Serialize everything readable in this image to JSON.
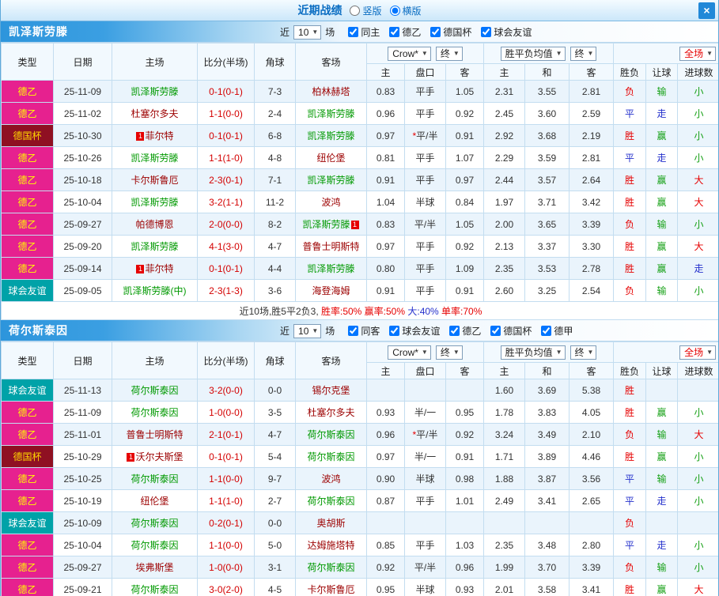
{
  "titlebar": {
    "title": "近期战绩",
    "vertical_label": "竖版",
    "horizontal_label": "横版",
    "close_label": "×"
  },
  "filter": {
    "near": "近",
    "matches": "场"
  },
  "table_header": {
    "type": "类型",
    "date": "日期",
    "home": "主场",
    "score": "比分(半场)",
    "corner": "角球",
    "away": "客场",
    "crown_select": "Crow*",
    "final_select": "终",
    "avg_select": "胜平负均值",
    "final2_select": "终",
    "full_select": "全场",
    "sub_home": "主",
    "sub_handicap": "盘口",
    "sub_away": "客",
    "sub_avg_home": "主",
    "sub_draw": "和",
    "sub_avg_away": "客",
    "sub_result": "胜负",
    "sub_handicap_result": "让球",
    "sub_goals": "进球数"
  },
  "league_colors": {
    "德乙": {
      "bg": "#e6218f",
      "fg": "#ffff00"
    },
    "德国杯": {
      "bg": "#8f1022",
      "fg": "#ffd800"
    },
    "球会友谊": {
      "bg": "#00a2a8",
      "fg": "#ffffff"
    }
  },
  "result_colors": {
    "胜": "#e60000",
    "平": "#2430cc",
    "负": "#e60000",
    "赢": "#15a015",
    "走": "#2430cc",
    "输": "#15a015",
    "大": "#e60000",
    "小": "#15a015"
  },
  "teams": [
    {
      "name": "凯泽斯劳滕",
      "games_count": "10",
      "filters": [
        "同主",
        "德乙",
        "德国杯",
        "球会友谊"
      ],
      "rows": [
        {
          "type": "德乙",
          "date": "25-11-09",
          "home": {
            "name": "凯泽斯劳滕",
            "self": true
          },
          "score": "0-1(0-1)",
          "corner": "7-3",
          "away": {
            "name": "柏林赫塔",
            "self": false
          },
          "odds": [
            "0.83",
            "平手",
            "1.05"
          ],
          "avg": [
            "2.31",
            "3.55",
            "2.81"
          ],
          "result": [
            "负",
            "输",
            "小"
          ]
        },
        {
          "type": "德乙",
          "date": "25-11-02",
          "home": {
            "name": "杜塞尔多夫",
            "self": false
          },
          "score": "1-1(0-0)",
          "corner": "2-4",
          "away": {
            "name": "凯泽斯劳滕",
            "self": true
          },
          "odds": [
            "0.96",
            "平手",
            "0.92"
          ],
          "avg": [
            "2.45",
            "3.60",
            "2.59"
          ],
          "result": [
            "平",
            "走",
            "小"
          ]
        },
        {
          "type": "德国杯",
          "date": "25-10-30",
          "home": {
            "name": "菲尔特",
            "self": false,
            "badge": "1",
            "badge_side": "left"
          },
          "score": "0-1(0-1)",
          "corner": "6-8",
          "away": {
            "name": "凯泽斯劳滕",
            "self": true
          },
          "odds": [
            "0.97",
            "*平/半",
            "0.91"
          ],
          "avg": [
            "2.92",
            "3.68",
            "2.19"
          ],
          "result": [
            "胜",
            "赢",
            "小"
          ]
        },
        {
          "type": "德乙",
          "date": "25-10-26",
          "home": {
            "name": "凯泽斯劳滕",
            "self": true
          },
          "score": "1-1(1-0)",
          "corner": "4-8",
          "away": {
            "name": "纽伦堡",
            "self": false
          },
          "odds": [
            "0.81",
            "平手",
            "1.07"
          ],
          "avg": [
            "2.29",
            "3.59",
            "2.81"
          ],
          "result": [
            "平",
            "走",
            "小"
          ]
        },
        {
          "type": "德乙",
          "date": "25-10-18",
          "home": {
            "name": "卡尔斯鲁厄",
            "self": false
          },
          "score": "2-3(0-1)",
          "corner": "7-1",
          "away": {
            "name": "凯泽斯劳滕",
            "self": true
          },
          "odds": [
            "0.91",
            "平手",
            "0.97"
          ],
          "avg": [
            "2.44",
            "3.57",
            "2.64"
          ],
          "result": [
            "胜",
            "赢",
            "大"
          ]
        },
        {
          "type": "德乙",
          "date": "25-10-04",
          "home": {
            "name": "凯泽斯劳滕",
            "self": true
          },
          "score": "3-2(1-1)",
          "corner": "11-2",
          "away": {
            "name": "波鸿",
            "self": false
          },
          "odds": [
            "1.04",
            "半球",
            "0.84"
          ],
          "avg": [
            "1.97",
            "3.71",
            "3.42"
          ],
          "result": [
            "胜",
            "赢",
            "大"
          ]
        },
        {
          "type": "德乙",
          "date": "25-09-27",
          "home": {
            "name": "帕德博恩",
            "self": false
          },
          "score": "2-0(0-0)",
          "corner": "8-2",
          "away": {
            "name": "凯泽斯劳滕",
            "self": true,
            "badge": "1",
            "badge_side": "right"
          },
          "odds": [
            "0.83",
            "平/半",
            "1.05"
          ],
          "avg": [
            "2.00",
            "3.65",
            "3.39"
          ],
          "result": [
            "负",
            "输",
            "小"
          ]
        },
        {
          "type": "德乙",
          "date": "25-09-20",
          "home": {
            "name": "凯泽斯劳滕",
            "self": true
          },
          "score": "4-1(3-0)",
          "corner": "4-7",
          "away": {
            "name": "普鲁士明斯特",
            "self": false
          },
          "odds": [
            "0.97",
            "平手",
            "0.92"
          ],
          "avg": [
            "2.13",
            "3.37",
            "3.30"
          ],
          "result": [
            "胜",
            "赢",
            "大"
          ]
        },
        {
          "type": "德乙",
          "date": "25-09-14",
          "home": {
            "name": "菲尔特",
            "self": false,
            "badge": "1",
            "badge_side": "left"
          },
          "score": "0-1(0-1)",
          "corner": "4-4",
          "away": {
            "name": "凯泽斯劳滕",
            "self": true
          },
          "odds": [
            "0.80",
            "平手",
            "1.09"
          ],
          "avg": [
            "2.35",
            "3.53",
            "2.78"
          ],
          "result": [
            "胜",
            "赢",
            "走"
          ]
        },
        {
          "type": "球会友谊",
          "date": "25-09-05",
          "home": {
            "name": "凯泽斯劳滕(中)",
            "self": true
          },
          "score": "2-3(1-3)",
          "corner": "3-6",
          "away": {
            "name": "海登海姆",
            "self": false
          },
          "odds": [
            "0.91",
            "平手",
            "0.91"
          ],
          "avg": [
            "2.60",
            "3.25",
            "2.54"
          ],
          "result": [
            "负",
            "输",
            "小"
          ]
        }
      ],
      "summary_segments": [
        {
          "text": "近10场,胜5平2负3, ",
          "color": "#333333"
        },
        {
          "text": "胜率:50%",
          "color": "#e60000"
        },
        {
          "text": " 赢率:50%",
          "color": "#e60000"
        },
        {
          "text": " 大:40%",
          "color": "#2430cc"
        },
        {
          "text": " 单率:70%",
          "color": "#e60000"
        }
      ]
    },
    {
      "name": "荷尔斯泰因",
      "games_count": "10",
      "filters": [
        "同客",
        "球会友谊",
        "德乙",
        "德国杯",
        "德甲"
      ],
      "rows": [
        {
          "type": "球会友谊",
          "date": "25-11-13",
          "home": {
            "name": "荷尔斯泰因",
            "self": true
          },
          "score": "3-2(0-0)",
          "corner": "0-0",
          "away": {
            "name": "锡尔克堡",
            "self": false
          },
          "odds": [
            "",
            "",
            ""
          ],
          "avg": [
            "1.60",
            "3.69",
            "5.38"
          ],
          "result": [
            "胜",
            "",
            ""
          ]
        },
        {
          "type": "德乙",
          "date": "25-11-09",
          "home": {
            "name": "荷尔斯泰因",
            "self": true
          },
          "score": "1-0(0-0)",
          "corner": "3-5",
          "away": {
            "name": "杜塞尔多夫",
            "self": false
          },
          "odds": [
            "0.93",
            "半/一",
            "0.95"
          ],
          "avg": [
            "1.78",
            "3.83",
            "4.05"
          ],
          "result": [
            "胜",
            "赢",
            "小"
          ]
        },
        {
          "type": "德乙",
          "date": "25-11-01",
          "home": {
            "name": "普鲁士明斯特",
            "self": false
          },
          "score": "2-1(0-1)",
          "corner": "4-7",
          "away": {
            "name": "荷尔斯泰因",
            "self": true
          },
          "odds": [
            "0.96",
            "*平/半",
            "0.92"
          ],
          "avg": [
            "3.24",
            "3.49",
            "2.10"
          ],
          "result": [
            "负",
            "输",
            "大"
          ]
        },
        {
          "type": "德国杯",
          "date": "25-10-29",
          "home": {
            "name": "沃尔夫斯堡",
            "self": false,
            "badge": "1",
            "badge_side": "left"
          },
          "score": "0-1(0-1)",
          "corner": "5-4",
          "away": {
            "name": "荷尔斯泰因",
            "self": true
          },
          "odds": [
            "0.97",
            "半/一",
            "0.91"
          ],
          "avg": [
            "1.71",
            "3.89",
            "4.46"
          ],
          "result": [
            "胜",
            "赢",
            "小"
          ]
        },
        {
          "type": "德乙",
          "date": "25-10-25",
          "home": {
            "name": "荷尔斯泰因",
            "self": true
          },
          "score": "1-1(0-0)",
          "corner": "9-7",
          "away": {
            "name": "波鸿",
            "self": false
          },
          "odds": [
            "0.90",
            "半球",
            "0.98"
          ],
          "avg": [
            "1.88",
            "3.87",
            "3.56"
          ],
          "result": [
            "平",
            "输",
            "小"
          ]
        },
        {
          "type": "德乙",
          "date": "25-10-19",
          "home": {
            "name": "纽伦堡",
            "self": false
          },
          "score": "1-1(1-0)",
          "corner": "2-7",
          "away": {
            "name": "荷尔斯泰因",
            "self": true
          },
          "odds": [
            "0.87",
            "平手",
            "1.01"
          ],
          "avg": [
            "2.49",
            "3.41",
            "2.65"
          ],
          "result": [
            "平",
            "走",
            "小"
          ]
        },
        {
          "type": "球会友谊",
          "date": "25-10-09",
          "home": {
            "name": "荷尔斯泰因",
            "self": true
          },
          "score": "0-2(0-1)",
          "corner": "0-0",
          "away": {
            "name": "奥胡斯",
            "self": false
          },
          "odds": [
            "",
            "",
            ""
          ],
          "avg": [
            "",
            "",
            ""
          ],
          "result": [
            "负",
            "",
            ""
          ]
        },
        {
          "type": "德乙",
          "date": "25-10-04",
          "home": {
            "name": "荷尔斯泰因",
            "self": true
          },
          "score": "1-1(0-0)",
          "corner": "5-0",
          "away": {
            "name": "达姆施塔特",
            "self": false
          },
          "odds": [
            "0.85",
            "平手",
            "1.03"
          ],
          "avg": [
            "2.35",
            "3.48",
            "2.80"
          ],
          "result": [
            "平",
            "走",
            "小"
          ]
        },
        {
          "type": "德乙",
          "date": "25-09-27",
          "home": {
            "name": "埃弗斯堡",
            "self": false
          },
          "score": "1-0(0-0)",
          "corner": "3-1",
          "away": {
            "name": "荷尔斯泰因",
            "self": true
          },
          "odds": [
            "0.92",
            "平/半",
            "0.96"
          ],
          "avg": [
            "1.99",
            "3.70",
            "3.39"
          ],
          "result": [
            "负",
            "输",
            "小"
          ]
        },
        {
          "type": "德乙",
          "date": "25-09-21",
          "home": {
            "name": "荷尔斯泰因",
            "self": true
          },
          "score": "3-0(2-0)",
          "corner": "4-5",
          "away": {
            "name": "卡尔斯鲁厄",
            "self": false
          },
          "odds": [
            "0.95",
            "半球",
            "0.93"
          ],
          "avg": [
            "2.01",
            "3.58",
            "3.41"
          ],
          "result": [
            "胜",
            "赢",
            "大"
          ]
        }
      ]
    }
  ]
}
